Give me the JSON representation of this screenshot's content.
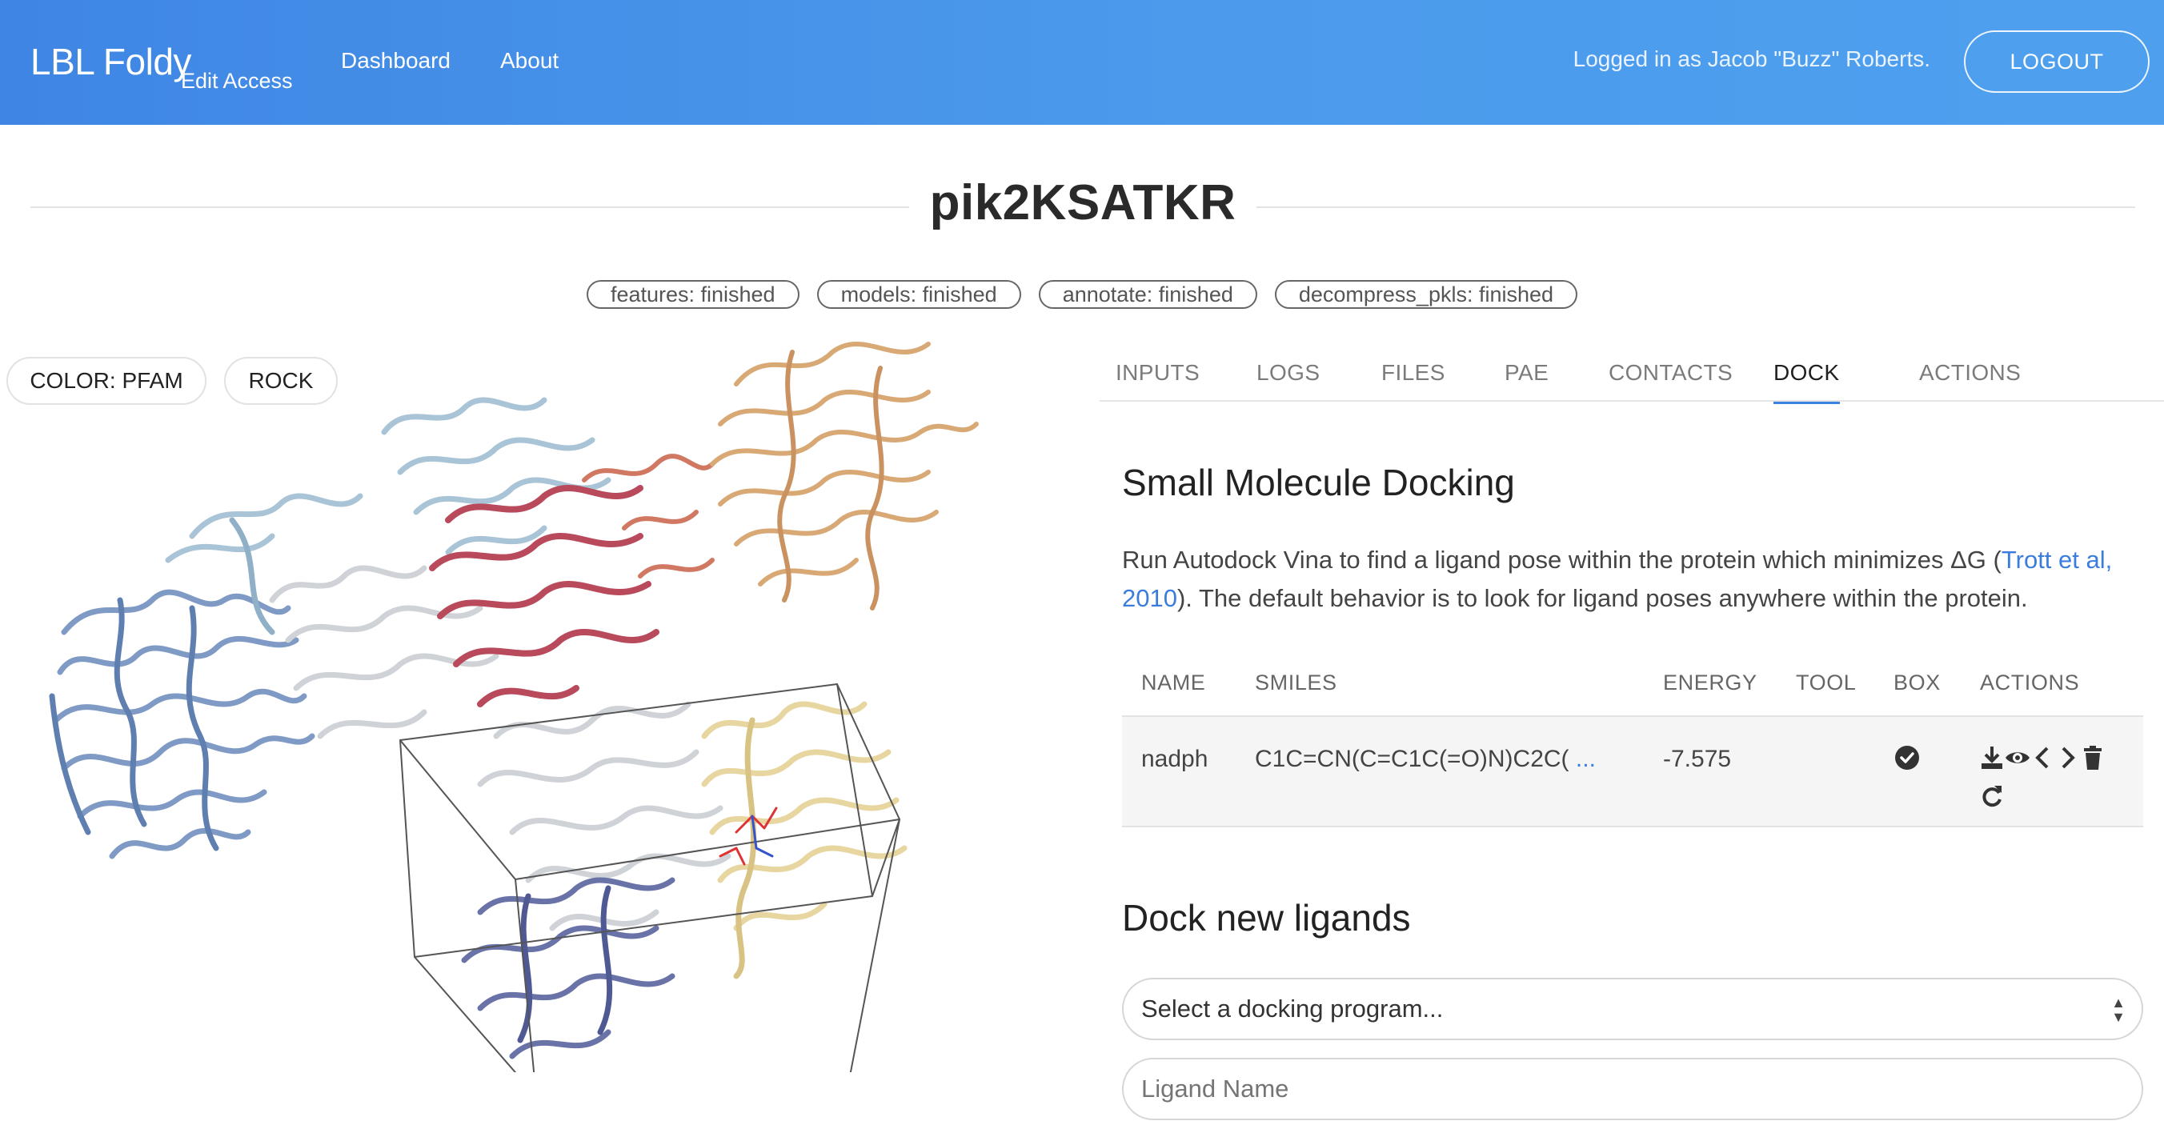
{
  "header": {
    "brand": "LBL Foldy",
    "brand_sub": "Edit Access",
    "nav": [
      "Dashboard",
      "About"
    ],
    "logged_in": "Logged in as Jacob \"Buzz\" Roberts.",
    "logout": "LOGOUT"
  },
  "page": {
    "title": "pik2KSATKR",
    "status_chips": [
      "features: finished",
      "models: finished",
      "annotate: finished",
      "decompress_pkls: finished"
    ]
  },
  "viewer": {
    "color_button": "COLOR: PFAM",
    "rock_button": "ROCK",
    "domain_colors": [
      "#7f9ac4",
      "#cfd2d6",
      "#a9c4d6",
      "#b84a5c",
      "#d8a875",
      "#e8d6a0",
      "#6a73a8",
      "#d07862"
    ]
  },
  "tabs": [
    "INPUTS",
    "LOGS",
    "FILES",
    "PAE",
    "CONTACTS",
    "DOCK",
    "ACTIONS"
  ],
  "active_tab": "DOCK",
  "dock": {
    "heading": "Small Molecule Docking",
    "desc_pre": "Run Autodock Vina to find a ligand pose within the protein which minimizes ΔG (",
    "desc_link": "Trott et al, 2010",
    "desc_post": "). The default behavior is to look for ligand poses anywhere within the protein.",
    "table": {
      "columns": [
        "NAME",
        "SMILES",
        "ENERGY",
        "TOOL",
        "BOX",
        "ACTIONS"
      ],
      "rows": [
        {
          "name": "nadph",
          "smiles": "C1C=CN(C=C1C(=O)N)C2C(",
          "smiles_more": "...",
          "energy": "-7.575",
          "tool": "",
          "box_icon": "check-circle-icon",
          "action_icons": [
            "download-icon",
            "eye-icon",
            "chevron-left-icon",
            "chevron-right-icon",
            "trash-icon",
            "redo-icon"
          ]
        }
      ]
    },
    "new_heading": "Dock new ligands",
    "program_select_placeholder": "Select a docking program...",
    "ligand_name_placeholder": "Ligand Name"
  }
}
